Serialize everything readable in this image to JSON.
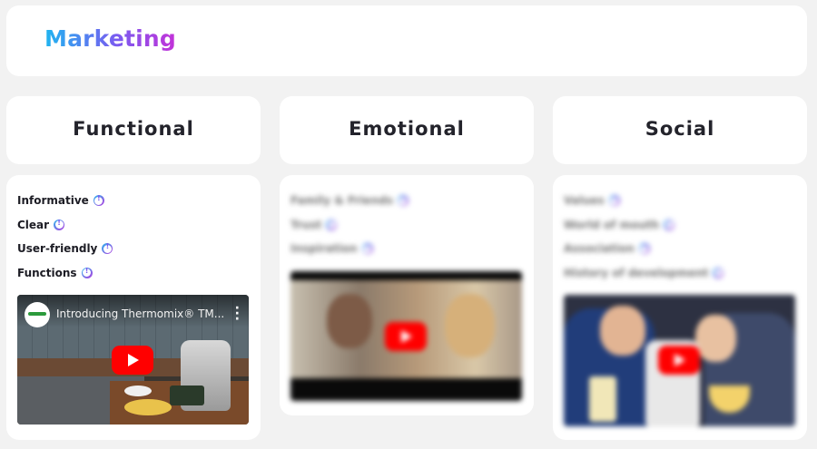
{
  "header": {
    "title": "Marketing"
  },
  "columns": [
    {
      "title": "Functional",
      "items": [
        "Informative",
        "Clear",
        "User-friendly",
        "Functions"
      ],
      "video": {
        "title": "Introducing Thermomix® TM..."
      }
    },
    {
      "title": "Emotional",
      "items": [
        "Family & Friends",
        "Trust",
        "Inspiration"
      ],
      "video": {
        "title": ""
      }
    },
    {
      "title": "Social",
      "items": [
        "Values",
        "World of mouth",
        "Association",
        "History of development"
      ],
      "video": {
        "title": ""
      }
    }
  ],
  "colors": {
    "gradient_start": "#1fb5f0",
    "gradient_end": "#c332d8",
    "youtube_red": "#ff0000",
    "card_bg": "#ffffff",
    "page_bg": "#f2f2f2"
  },
  "icons": {
    "info": "info-icon",
    "play": "youtube-play-icon",
    "more": "more-vert-icon",
    "channel": "channel-logo"
  }
}
